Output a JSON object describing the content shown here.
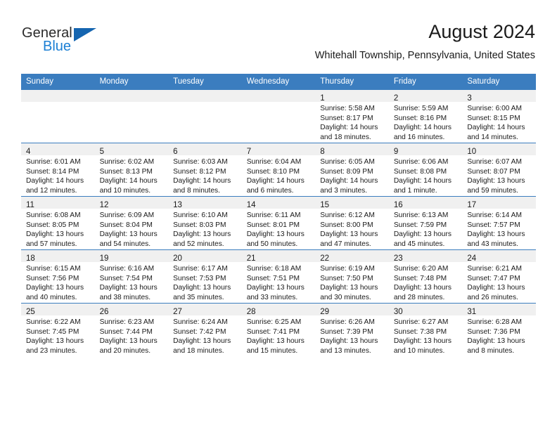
{
  "brand": {
    "name_part1": "General",
    "name_part2": "Blue",
    "flag_icon": "triangle-flag-icon",
    "accent_color": "#1b7fd4",
    "flag_color": "#1565b0"
  },
  "header": {
    "month_title": "August 2024",
    "location": "Whitehall Township, Pennsylvania, United States"
  },
  "theme": {
    "header_row_bg": "#3b7dbf",
    "daynum_band_bg": "#f0f0f0",
    "grid_line": "#3b7dbf",
    "text": "#1a1a1a"
  },
  "weekday_headers": [
    "Sunday",
    "Monday",
    "Tuesday",
    "Wednesday",
    "Thursday",
    "Friday",
    "Saturday"
  ],
  "weeks": [
    [
      {
        "day": "",
        "lines": []
      },
      {
        "day": "",
        "lines": []
      },
      {
        "day": "",
        "lines": []
      },
      {
        "day": "",
        "lines": []
      },
      {
        "day": "1",
        "lines": [
          "Sunrise: 5:58 AM",
          "Sunset: 8:17 PM",
          "Daylight: 14 hours",
          "and 18 minutes."
        ]
      },
      {
        "day": "2",
        "lines": [
          "Sunrise: 5:59 AM",
          "Sunset: 8:16 PM",
          "Daylight: 14 hours",
          "and 16 minutes."
        ]
      },
      {
        "day": "3",
        "lines": [
          "Sunrise: 6:00 AM",
          "Sunset: 8:15 PM",
          "Daylight: 14 hours",
          "and 14 minutes."
        ]
      }
    ],
    [
      {
        "day": "4",
        "lines": [
          "Sunrise: 6:01 AM",
          "Sunset: 8:14 PM",
          "Daylight: 14 hours",
          "and 12 minutes."
        ]
      },
      {
        "day": "5",
        "lines": [
          "Sunrise: 6:02 AM",
          "Sunset: 8:13 PM",
          "Daylight: 14 hours",
          "and 10 minutes."
        ]
      },
      {
        "day": "6",
        "lines": [
          "Sunrise: 6:03 AM",
          "Sunset: 8:12 PM",
          "Daylight: 14 hours",
          "and 8 minutes."
        ]
      },
      {
        "day": "7",
        "lines": [
          "Sunrise: 6:04 AM",
          "Sunset: 8:10 PM",
          "Daylight: 14 hours",
          "and 6 minutes."
        ]
      },
      {
        "day": "8",
        "lines": [
          "Sunrise: 6:05 AM",
          "Sunset: 8:09 PM",
          "Daylight: 14 hours",
          "and 3 minutes."
        ]
      },
      {
        "day": "9",
        "lines": [
          "Sunrise: 6:06 AM",
          "Sunset: 8:08 PM",
          "Daylight: 14 hours",
          "and 1 minute."
        ]
      },
      {
        "day": "10",
        "lines": [
          "Sunrise: 6:07 AM",
          "Sunset: 8:07 PM",
          "Daylight: 13 hours",
          "and 59 minutes."
        ]
      }
    ],
    [
      {
        "day": "11",
        "lines": [
          "Sunrise: 6:08 AM",
          "Sunset: 8:05 PM",
          "Daylight: 13 hours",
          "and 57 minutes."
        ]
      },
      {
        "day": "12",
        "lines": [
          "Sunrise: 6:09 AM",
          "Sunset: 8:04 PM",
          "Daylight: 13 hours",
          "and 54 minutes."
        ]
      },
      {
        "day": "13",
        "lines": [
          "Sunrise: 6:10 AM",
          "Sunset: 8:03 PM",
          "Daylight: 13 hours",
          "and 52 minutes."
        ]
      },
      {
        "day": "14",
        "lines": [
          "Sunrise: 6:11 AM",
          "Sunset: 8:01 PM",
          "Daylight: 13 hours",
          "and 50 minutes."
        ]
      },
      {
        "day": "15",
        "lines": [
          "Sunrise: 6:12 AM",
          "Sunset: 8:00 PM",
          "Daylight: 13 hours",
          "and 47 minutes."
        ]
      },
      {
        "day": "16",
        "lines": [
          "Sunrise: 6:13 AM",
          "Sunset: 7:59 PM",
          "Daylight: 13 hours",
          "and 45 minutes."
        ]
      },
      {
        "day": "17",
        "lines": [
          "Sunrise: 6:14 AM",
          "Sunset: 7:57 PM",
          "Daylight: 13 hours",
          "and 43 minutes."
        ]
      }
    ],
    [
      {
        "day": "18",
        "lines": [
          "Sunrise: 6:15 AM",
          "Sunset: 7:56 PM",
          "Daylight: 13 hours",
          "and 40 minutes."
        ]
      },
      {
        "day": "19",
        "lines": [
          "Sunrise: 6:16 AM",
          "Sunset: 7:54 PM",
          "Daylight: 13 hours",
          "and 38 minutes."
        ]
      },
      {
        "day": "20",
        "lines": [
          "Sunrise: 6:17 AM",
          "Sunset: 7:53 PM",
          "Daylight: 13 hours",
          "and 35 minutes."
        ]
      },
      {
        "day": "21",
        "lines": [
          "Sunrise: 6:18 AM",
          "Sunset: 7:51 PM",
          "Daylight: 13 hours",
          "and 33 minutes."
        ]
      },
      {
        "day": "22",
        "lines": [
          "Sunrise: 6:19 AM",
          "Sunset: 7:50 PM",
          "Daylight: 13 hours",
          "and 30 minutes."
        ]
      },
      {
        "day": "23",
        "lines": [
          "Sunrise: 6:20 AM",
          "Sunset: 7:48 PM",
          "Daylight: 13 hours",
          "and 28 minutes."
        ]
      },
      {
        "day": "24",
        "lines": [
          "Sunrise: 6:21 AM",
          "Sunset: 7:47 PM",
          "Daylight: 13 hours",
          "and 26 minutes."
        ]
      }
    ],
    [
      {
        "day": "25",
        "lines": [
          "Sunrise: 6:22 AM",
          "Sunset: 7:45 PM",
          "Daylight: 13 hours",
          "and 23 minutes."
        ]
      },
      {
        "day": "26",
        "lines": [
          "Sunrise: 6:23 AM",
          "Sunset: 7:44 PM",
          "Daylight: 13 hours",
          "and 20 minutes."
        ]
      },
      {
        "day": "27",
        "lines": [
          "Sunrise: 6:24 AM",
          "Sunset: 7:42 PM",
          "Daylight: 13 hours",
          "and 18 minutes."
        ]
      },
      {
        "day": "28",
        "lines": [
          "Sunrise: 6:25 AM",
          "Sunset: 7:41 PM",
          "Daylight: 13 hours",
          "and 15 minutes."
        ]
      },
      {
        "day": "29",
        "lines": [
          "Sunrise: 6:26 AM",
          "Sunset: 7:39 PM",
          "Daylight: 13 hours",
          "and 13 minutes."
        ]
      },
      {
        "day": "30",
        "lines": [
          "Sunrise: 6:27 AM",
          "Sunset: 7:38 PM",
          "Daylight: 13 hours",
          "and 10 minutes."
        ]
      },
      {
        "day": "31",
        "lines": [
          "Sunrise: 6:28 AM",
          "Sunset: 7:36 PM",
          "Daylight: 13 hours",
          "and 8 minutes."
        ]
      }
    ]
  ]
}
